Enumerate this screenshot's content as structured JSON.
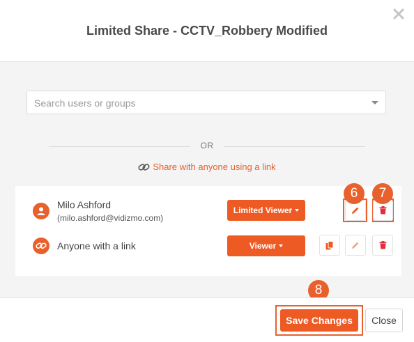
{
  "dialog": {
    "title": "Limited Share - CCTV_Robbery Modified",
    "close_icon": "close-x-icon"
  },
  "search": {
    "placeholder": "Search users or groups",
    "value": ""
  },
  "separator": {
    "text": "OR"
  },
  "share_link": {
    "icon": "link-icon",
    "label": "Share with anyone using a link"
  },
  "users": [
    {
      "name": "Milo Ashford",
      "email": "(milo.ashford@vidizmo.com)",
      "icon": "user-icon",
      "role": "Limited Viewer",
      "actions": [
        "edit-icon",
        "delete-icon"
      ]
    },
    {
      "name": "Anyone with a link",
      "icon": "link-icon",
      "role": "Viewer",
      "actions": [
        "copy-icon",
        "edit-icon",
        "delete-icon"
      ]
    }
  ],
  "annotations": {
    "edit_step": "6",
    "delete_step": "7",
    "save_step": "8"
  },
  "footer": {
    "save_label": "Save Changes",
    "close_label": "Close"
  },
  "colors": {
    "accent": "#ee5a24",
    "highlight": "#e8612c",
    "disabled_icon": "#f2a88e"
  }
}
